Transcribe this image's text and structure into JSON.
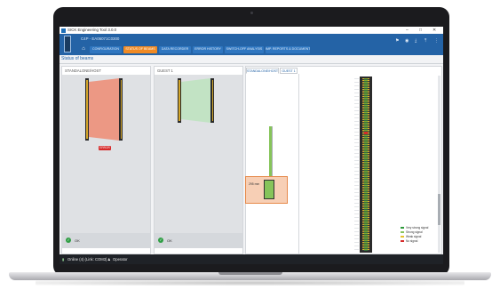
{
  "app": {
    "title": "SICK Engineering Tool 3.0.0",
    "device_name": "C4P - EA06071C0300",
    "window_controls": [
      "–",
      "□",
      "✕"
    ],
    "header_icons": [
      "flag-icon",
      "eye-icon",
      "download-icon",
      "upload-icon",
      "more-icon"
    ]
  },
  "nav": {
    "home_icon": "home-icon",
    "tabs": [
      {
        "label": "CONFIGURATION",
        "active": false
      },
      {
        "label": "STATUS OF BEAMS",
        "active": true
      },
      {
        "label": "DATA RECORDER",
        "active": false
      },
      {
        "label": "ERROR HISTORY",
        "active": false
      },
      {
        "label": "SWITCH-OFF ANALYSIS",
        "active": false
      },
      {
        "label": "IMP. REPORTS & DOCUMENTS",
        "active": false
      }
    ]
  },
  "page": {
    "title": "Status of beams"
  },
  "panels": {
    "host": {
      "title": "STANDALONE/HOST",
      "badge": "ERROR",
      "status": "OK"
    },
    "guest": {
      "title": "GUEST 1",
      "status": "OK"
    }
  },
  "detail": {
    "tabs": [
      {
        "label": "STANDALONE/HOST",
        "active": true
      },
      {
        "label": "GUEST 1",
        "active": false
      }
    ],
    "zoom_label": "295 mm",
    "legend": [
      {
        "label": "Very strong signal",
        "color": "#2e9a3a"
      },
      {
        "label": "Strong signal",
        "color": "#86c45a"
      },
      {
        "label": "Weak signal",
        "color": "#e6c229"
      },
      {
        "label": "No signal",
        "color": "#d62a2a"
      }
    ]
  },
  "statusbar": {
    "connection": "Online (4) (Link: COM3)",
    "user": "Operator"
  }
}
